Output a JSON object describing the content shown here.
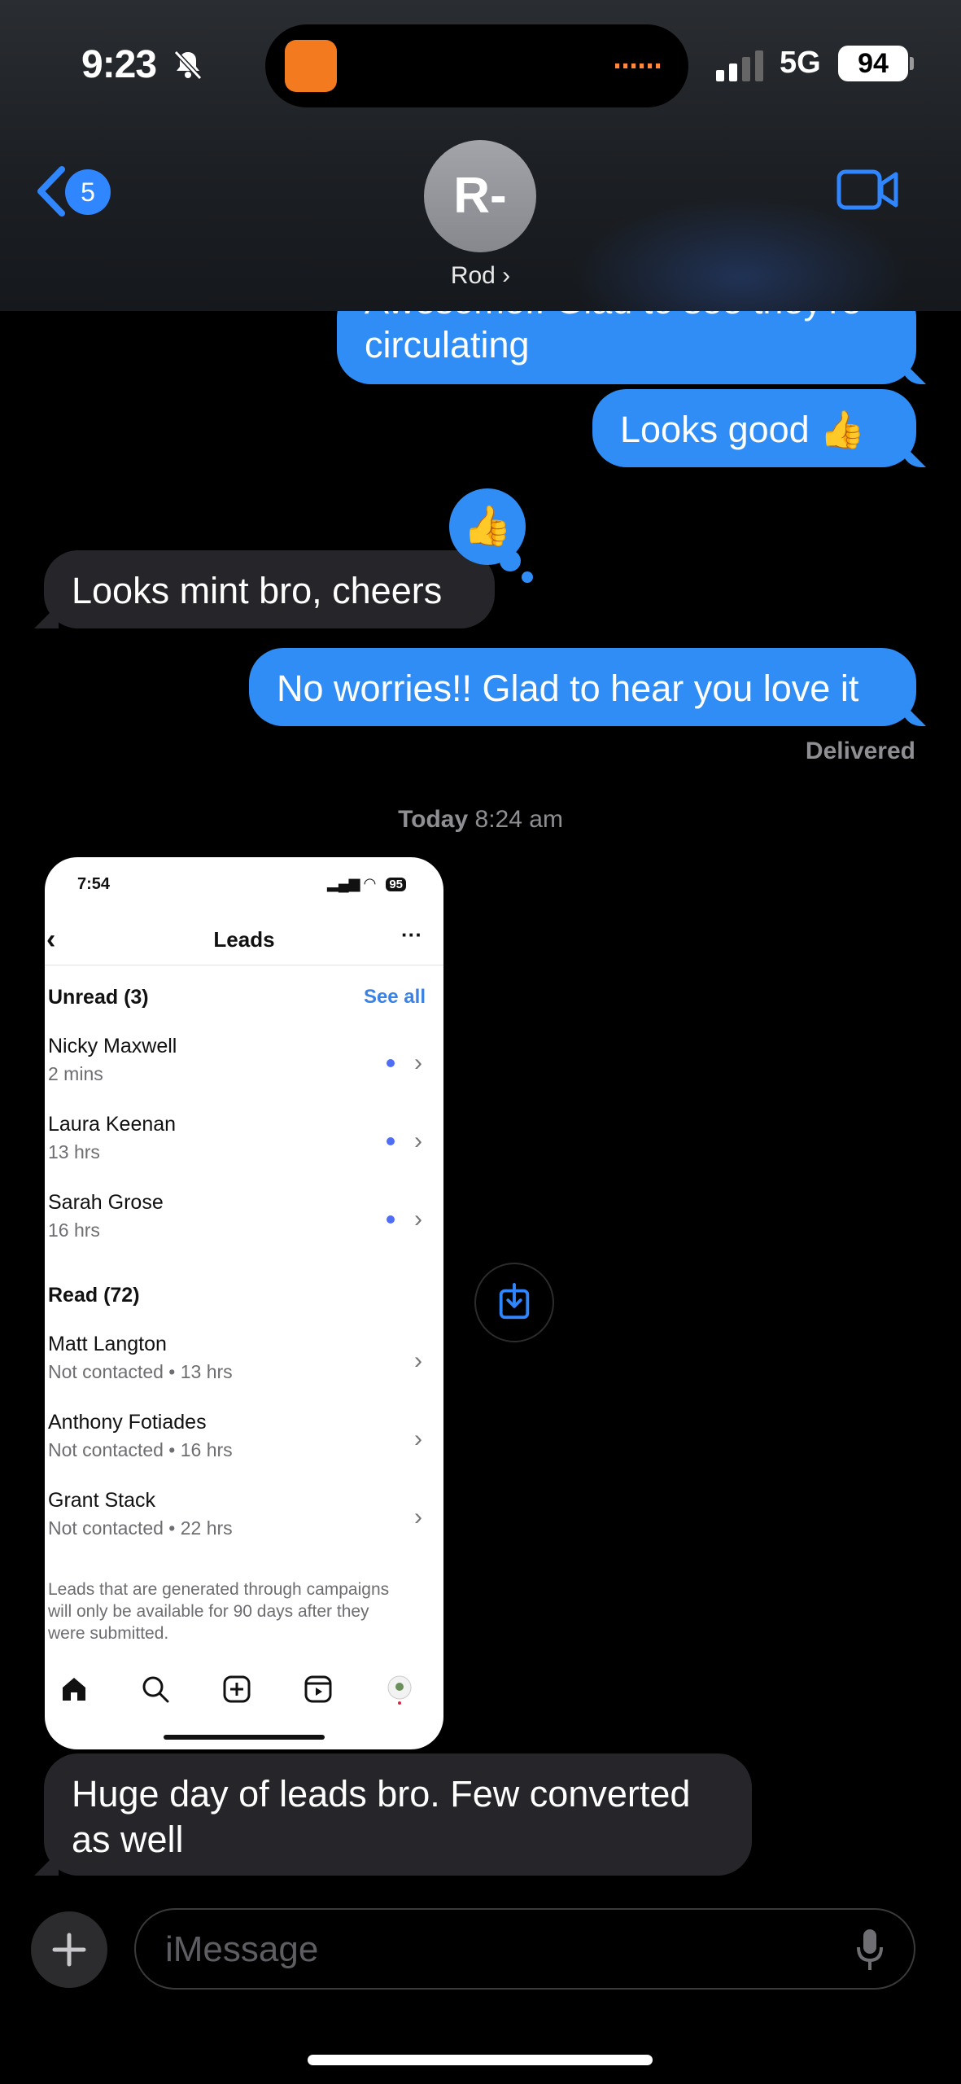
{
  "status_bar": {
    "time": "9:23",
    "network": "5G",
    "battery": "94"
  },
  "nav": {
    "back_count": "5",
    "avatar_initials": "R-",
    "contact_name": "Rod ›"
  },
  "messages": [
    {
      "dir": "out",
      "text": "circulating",
      "cut_text": "Awesome!! Glad to see they're"
    },
    {
      "dir": "out",
      "text": "Looks good 👍"
    },
    {
      "dir": "in",
      "text": "Looks mint bro, cheers",
      "tapback": "👍"
    },
    {
      "dir": "out",
      "text": "No worries!! Glad to hear you love it"
    },
    {
      "dir": "in",
      "text": "Huge day of leads bro. Few converted as well"
    }
  ],
  "delivered": "Delivered",
  "timestamp": {
    "day": "Today",
    "time": "8:24 am"
  },
  "screenshot": {
    "time": "7:54",
    "battery": "95",
    "title": "Leads",
    "more": "···",
    "unread_header": "Unread (3)",
    "see_all": "See all",
    "unread": [
      {
        "name": "Nicky Maxwell",
        "sub": "2 mins"
      },
      {
        "name": "Laura Keenan",
        "sub": "13 hrs"
      },
      {
        "name": "Sarah Grose",
        "sub": "16 hrs"
      }
    ],
    "read_header": "Read (72)",
    "read": [
      {
        "name": "Matt Langton",
        "sub": "Not contacted • 13 hrs"
      },
      {
        "name": "Anthony Fotiades",
        "sub": "Not contacted • 16 hrs"
      },
      {
        "name": "Grant Stack",
        "sub": "Not contacted • 22 hrs"
      }
    ],
    "footer": "Leads that are generated through campaigns will only be available for 90 days after they were submitted."
  },
  "composer": {
    "placeholder": "iMessage"
  },
  "colors": {
    "outgoing": "#2f8df5",
    "incoming": "#26262a",
    "accent": "#2f86ff"
  }
}
